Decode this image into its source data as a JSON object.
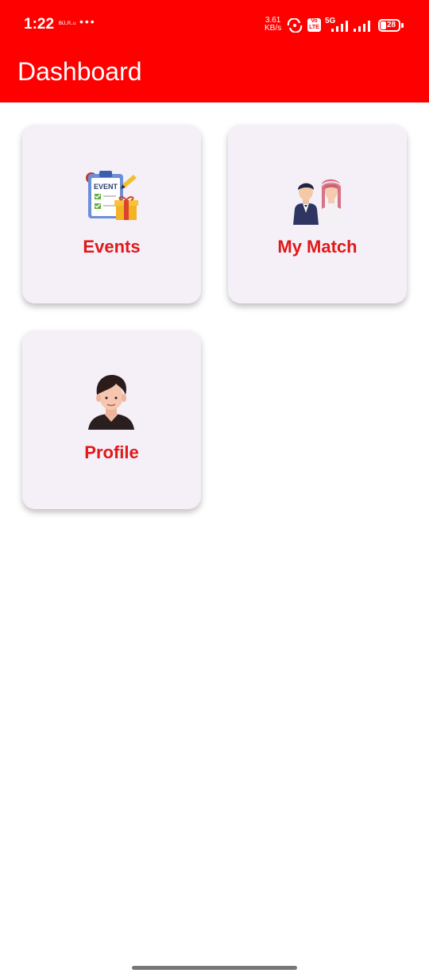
{
  "status_bar": {
    "time": "1:22",
    "notification_text": "ᴮᴵᴶ·ᴿ·ᵘ",
    "dots": "•••",
    "speed_value": "3.61",
    "speed_unit": "KB/s",
    "network": "5G",
    "volte": "Vo LTE",
    "battery": "28"
  },
  "app_bar": {
    "title": "Dashboard",
    "color": "#ff0000"
  },
  "menu": [
    {
      "label": "Events",
      "icon": "event-clipboard-icon"
    },
    {
      "label": "My Match",
      "icon": "couple-icon"
    },
    {
      "label": "Profile",
      "icon": "person-icon"
    }
  ],
  "theme": {
    "label_color": "#e01818",
    "card_color": "#f5f0f8"
  }
}
